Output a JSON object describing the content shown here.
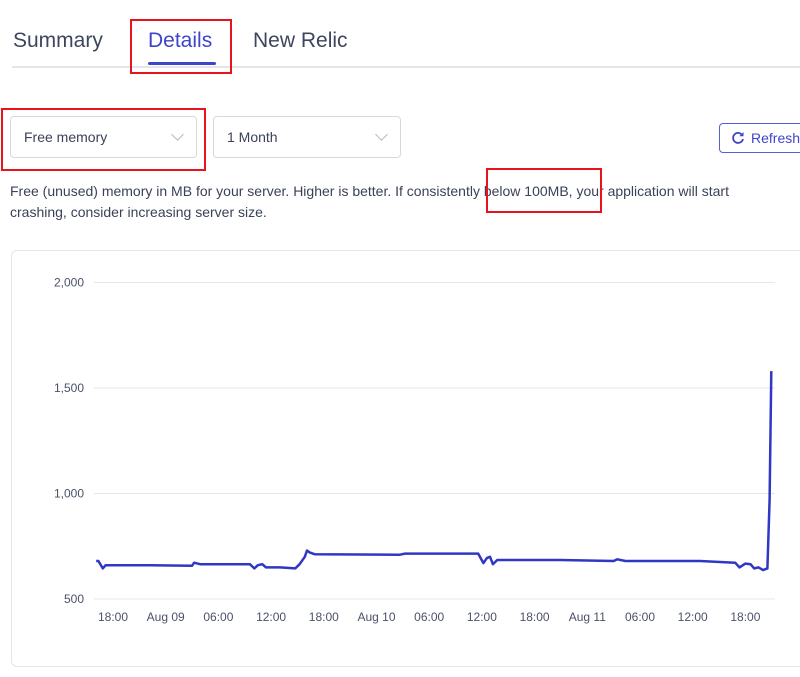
{
  "tabs": [
    {
      "label": "Summary",
      "active": false
    },
    {
      "label": "Details",
      "active": true
    },
    {
      "label": "New Relic",
      "active": false
    }
  ],
  "controls": {
    "metric_select": {
      "value": "Free memory",
      "icon": "chevron-down-icon"
    },
    "range_select": {
      "value": "1 Month",
      "icon": "chevron-down-icon"
    },
    "refresh_button": {
      "label": "Refresh",
      "icon": "refresh-icon"
    }
  },
  "description": "Free (unused) memory in MB for your server. Higher is better. If consistently below 100MB, your application will start crashing, consider increasing server size.",
  "colors": {
    "accent": "#3f45c9",
    "line": "#2f37c4",
    "highlight": "#e8141b"
  },
  "chart_data": {
    "type": "line",
    "title": "",
    "xlabel": "",
    "ylabel": "",
    "ylim": [
      500,
      2000
    ],
    "yticks": [
      {
        "v": 500,
        "label": "500"
      },
      {
        "v": 1000,
        "label": "1,000"
      },
      {
        "v": 1500,
        "label": "1,500"
      },
      {
        "v": 2000,
        "label": "2,000"
      }
    ],
    "xticks": [
      {
        "t": "08-08 18:00",
        "label": "18:00"
      },
      {
        "t": "08-09 00:00",
        "label": "Aug 09"
      },
      {
        "t": "08-09 06:00",
        "label": "06:00"
      },
      {
        "t": "08-09 12:00",
        "label": "12:00"
      },
      {
        "t": "08-09 18:00",
        "label": "18:00"
      },
      {
        "t": "08-10 00:00",
        "label": "Aug 10"
      },
      {
        "t": "08-10 06:00",
        "label": "06:00"
      },
      {
        "t": "08-10 12:00",
        "label": "12:00"
      },
      {
        "t": "08-10 18:00",
        "label": "18:00"
      },
      {
        "t": "08-11 00:00",
        "label": "Aug 11"
      },
      {
        "t": "08-11 06:00",
        "label": "06:00"
      },
      {
        "t": "08-11 12:00",
        "label": "12:00"
      },
      {
        "t": "08-11 18:00",
        "label": "18:00"
      }
    ],
    "grid": true,
    "series": [
      {
        "points": [
          [
            "08-08 16:05",
            680
          ],
          [
            "08-08 16:20",
            680
          ],
          [
            "08-08 16:50",
            645
          ],
          [
            "08-08 17:10",
            660
          ],
          [
            "08-08 22:15",
            660
          ],
          [
            "08-09 03:00",
            658
          ],
          [
            "08-09 03:15",
            672
          ],
          [
            "08-09 03:55",
            665
          ],
          [
            "08-09 09:35",
            665
          ],
          [
            "08-09 10:05",
            645
          ],
          [
            "08-09 10:30",
            660
          ],
          [
            "08-09 11:00",
            665
          ],
          [
            "08-09 11:25",
            650
          ],
          [
            "08-09 13:00",
            650
          ],
          [
            "08-09 14:45",
            645
          ],
          [
            "08-09 15:15",
            665
          ],
          [
            "08-09 15:50",
            700
          ],
          [
            "08-09 16:05",
            730
          ],
          [
            "08-09 16:25",
            720
          ],
          [
            "08-09 17:00",
            712
          ],
          [
            "08-10 02:40",
            710
          ],
          [
            "08-10 03:15",
            715
          ],
          [
            "08-10 11:35",
            715
          ],
          [
            "08-10 12:10",
            670
          ],
          [
            "08-10 12:35",
            695
          ],
          [
            "08-10 12:55",
            700
          ],
          [
            "08-10 13:15",
            665
          ],
          [
            "08-10 13:45",
            685
          ],
          [
            "08-10 20:55",
            685
          ],
          [
            "08-11 03:00",
            680
          ],
          [
            "08-11 03:25",
            688
          ],
          [
            "08-11 04:20",
            680
          ],
          [
            "08-11 12:50",
            680
          ],
          [
            "08-11 16:50",
            672
          ],
          [
            "08-11 17:20",
            650
          ],
          [
            "08-11 18:00",
            668
          ],
          [
            "08-11 18:35",
            665
          ],
          [
            "08-11 19:00",
            645
          ],
          [
            "08-11 19:30",
            650
          ],
          [
            "08-11 20:00",
            637
          ],
          [
            "08-11 20:30",
            645
          ],
          [
            "08-11 20:45",
            970
          ],
          [
            "08-11 20:57",
            1580
          ]
        ]
      }
    ]
  }
}
